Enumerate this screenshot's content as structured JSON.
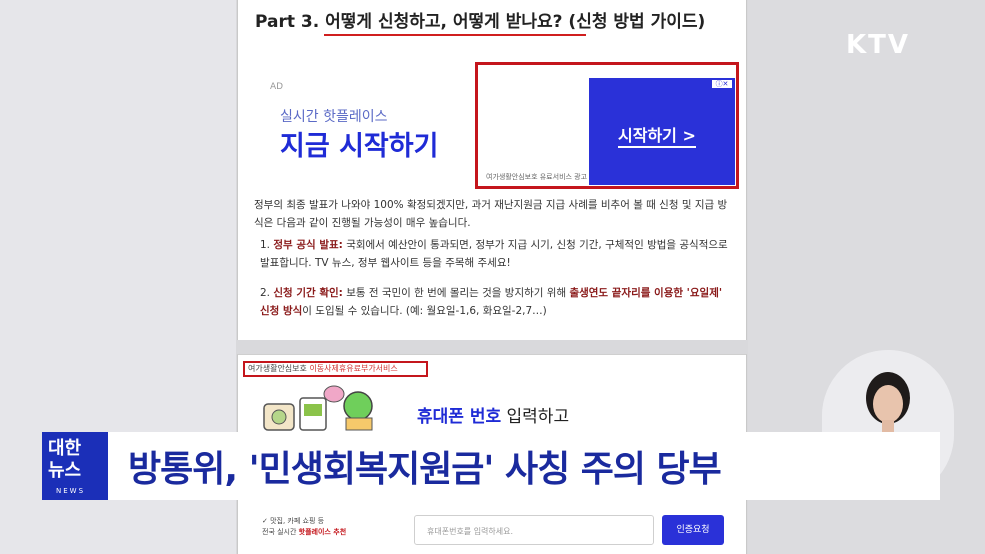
{
  "channel_logo": "KTV",
  "article": {
    "part_title": "Part 3. 어떻게 신청하고, 어떻게 받나요? (신청 방법 가이드)",
    "ad": {
      "label": "AD",
      "subtitle": "실시간 핫플레이스",
      "headline": "지금 시작하기",
      "cta": "시작하기 >",
      "footer": "여가생활안심보호 유료서비스 광고"
    },
    "intro": "정부의 최종 발표가 나와야 100% 확정되겠지만, 과거 재난지원금 지급 사례를 비추어 볼 때 신청 및 지급 방식은 다음과 같이 진행될 가능성이 매우 높습니다.",
    "items": [
      {
        "number": "1.",
        "title": "정부 공식 발표:",
        "text": "국회에서 예산안이 통과되면, 정부가 지급 시기, 신청 기간, 구체적인 방법을 공식적으로 발표합니다. TV 뉴스, 정부 웹사이트 등을 주목해 주세요!"
      },
      {
        "number": "2.",
        "title": "신청 기간 확인:",
        "text_before": "보통 전 국민이 한 번에 몰리는 것을 방지하기 위해",
        "highlight": "출생연도 끝자리를 이용한 '요일제' 신청 방식",
        "text_after": "이 도입될 수 있습니다. (예: 월요일-1,6, 화요일-2,7…)"
      }
    ]
  },
  "lower_ad": {
    "tag_black": "여가생활안심보호",
    "tag_red": "이동사제휴유료부가서비스",
    "phone_bold": "휴대폰 번호",
    "phone_rest": " 입력하고",
    "check_line1": "✓ 맛집, 카페 쇼핑 등",
    "check_line2_prefix": "전국 실시간 ",
    "check_line2_red": "핫플레이스 추천",
    "input_placeholder": "휴대폰번호를 입력하세요.",
    "verify_button": "인증요청"
  },
  "news_banner": {
    "logo_line1": "대한",
    "logo_line2": "뉴스",
    "logo_sub": "NEWS",
    "headline": "방통위, '민생회복지원금' 사칭 주의 당부"
  },
  "colors": {
    "banner_blue": "#1b2fb8",
    "headline_text": "#1a2a9e",
    "highlight_red": "#c4161c",
    "ad_blue": "#2a31d8"
  }
}
